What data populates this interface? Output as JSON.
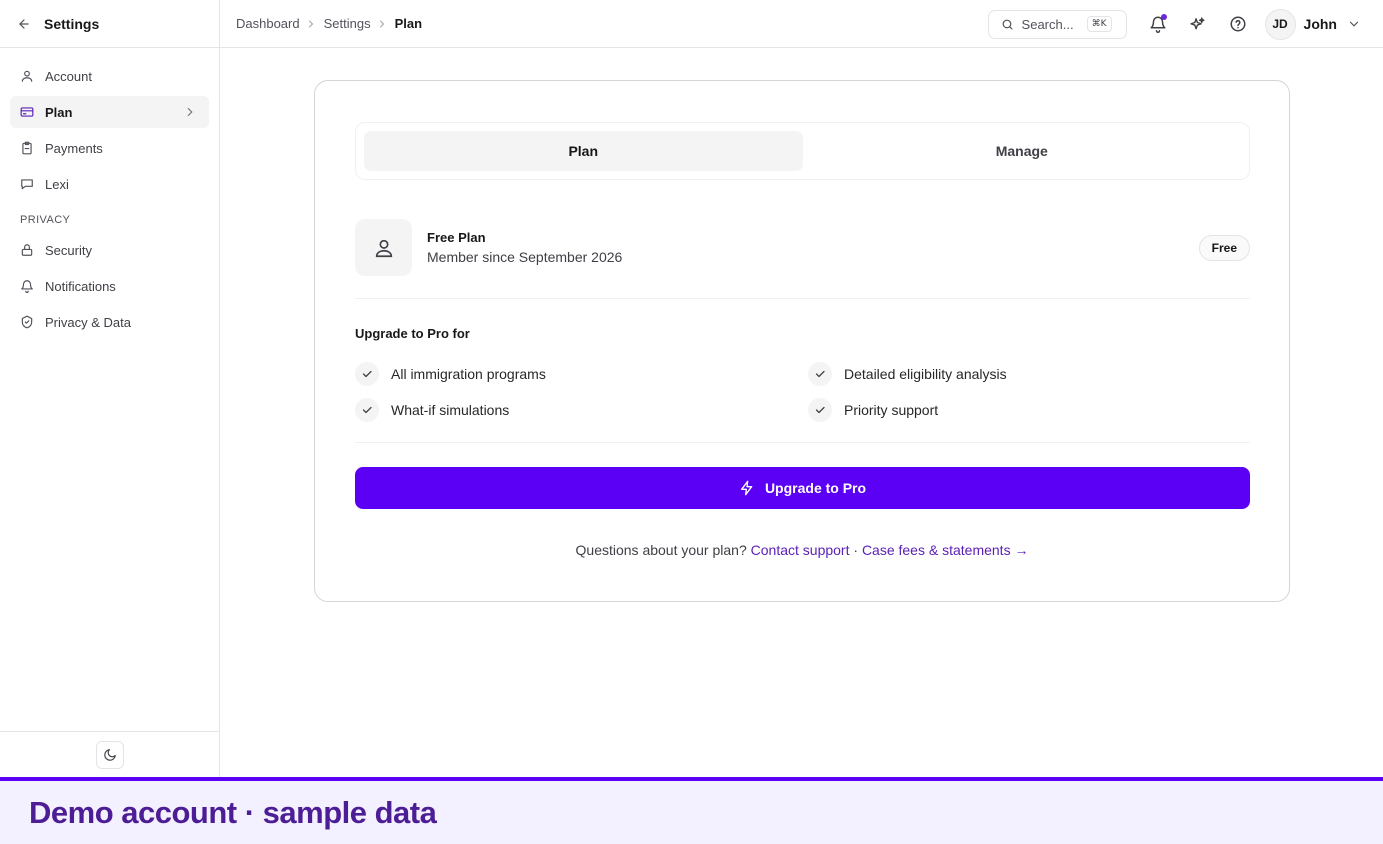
{
  "sidebar": {
    "title": "Settings",
    "items": [
      {
        "label": "Account",
        "icon": "user-icon"
      },
      {
        "label": "Plan",
        "icon": "card-icon"
      },
      {
        "label": "Payments",
        "icon": "clipboard-icon"
      },
      {
        "label": "Lexi",
        "icon": "chat-icon"
      }
    ],
    "privacy_section": "PRIVACY",
    "privacy_items": [
      {
        "label": "Security",
        "icon": "lock-icon"
      },
      {
        "label": "Notifications",
        "icon": "bell-icon"
      },
      {
        "label": "Privacy & Data",
        "icon": "shield-icon"
      }
    ]
  },
  "header": {
    "breadcrumbs": [
      "Dashboard",
      "Settings",
      "Plan"
    ],
    "search_placeholder": "Search...",
    "search_shortcut": "⌘K",
    "user_initials": "JD",
    "user_name": "John"
  },
  "main": {
    "tabs": [
      {
        "label": "Plan"
      },
      {
        "label": "Manage"
      }
    ],
    "plan": {
      "name": "Free Plan",
      "since": "Member since September 2026",
      "badge": "Free"
    },
    "upgrade_title": "Upgrade to Pro for",
    "features": [
      "All immigration programs",
      "Detailed eligibility analysis",
      "What-if simulations",
      "Priority support"
    ],
    "upgrade_button": "Upgrade to Pro",
    "footer": {
      "question": "Questions about your plan?",
      "contact": "Contact support",
      "separator": "·",
      "fees": "Case fees & statements →"
    }
  },
  "banner": {
    "text": "Demo account · sample data"
  },
  "colors": {
    "accent": "#5b00f5",
    "link": "#5b21b6",
    "banner_bg": "#f3f0ff"
  }
}
